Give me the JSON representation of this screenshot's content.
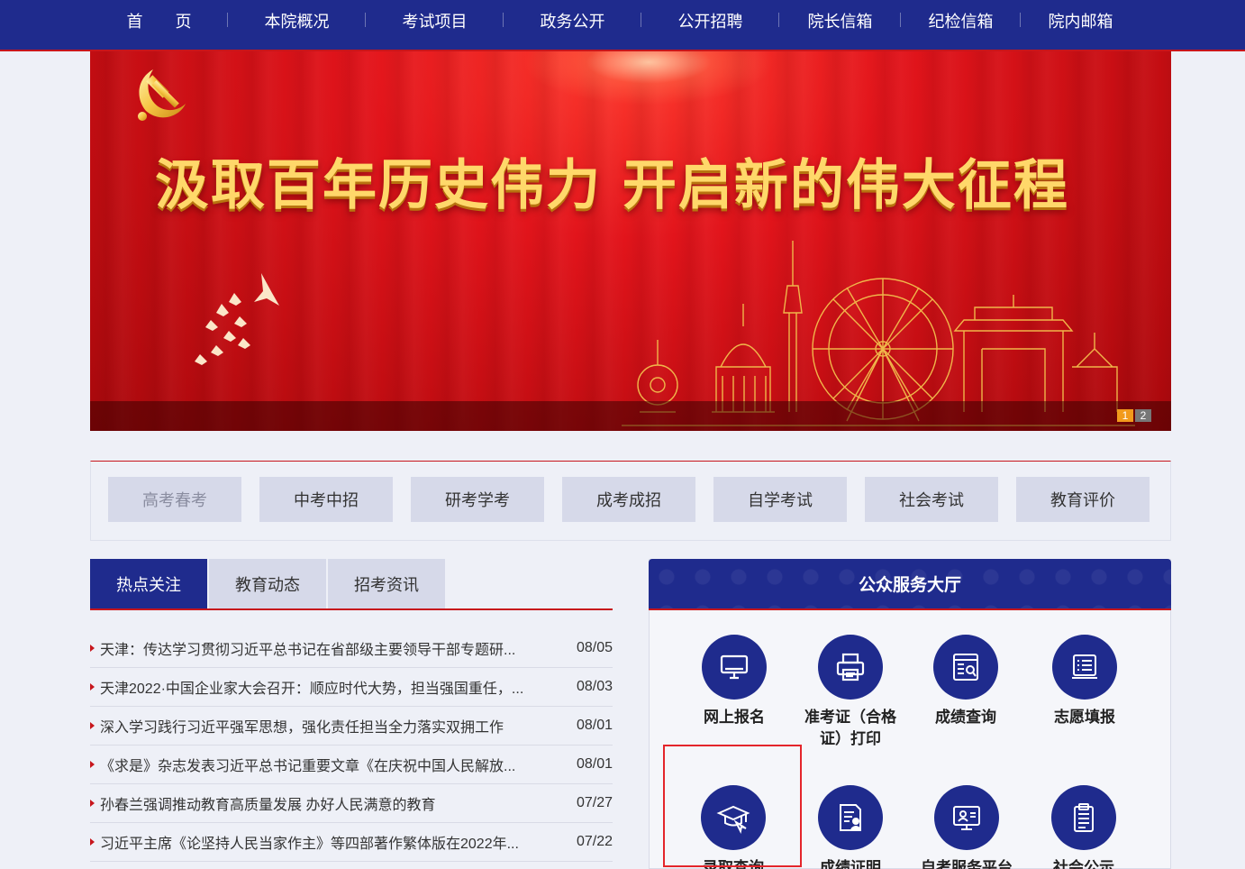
{
  "nav": {
    "items": [
      "首　　页",
      "本院概况",
      "考试项目",
      "政务公开",
      "公开招聘",
      "院长信箱",
      "纪检信箱",
      "院内邮箱"
    ]
  },
  "banner": {
    "headline": "汲取百年历史伟力  开启新的伟大征程",
    "pages": [
      "1",
      "2"
    ],
    "active_page": "1"
  },
  "categories": {
    "items": [
      "高考春考",
      "中考中招",
      "研考学考",
      "成考成招",
      "自学考试",
      "社会考试",
      "教育评价"
    ],
    "selected": "高考春考"
  },
  "news": {
    "tabs": [
      "热点关注",
      "教育动态",
      "招考资讯"
    ],
    "active_tab": "热点关注",
    "items": [
      {
        "title": "天津：传达学习贯彻习近平总书记在省部级主要领导干部专题研...",
        "date": "08/05"
      },
      {
        "title": "天津2022·中国企业家大会召开：顺应时代大势，担当强国重任，...",
        "date": "08/03"
      },
      {
        "title": "深入学习践行习近平强军思想，强化责任担当全力落实双拥工作",
        "date": "08/01"
      },
      {
        "title": "《求是》杂志发表习近平总书记重要文章《在庆祝中国人民解放...",
        "date": "08/01"
      },
      {
        "title": "孙春兰强调推动教育高质量发展 办好人民满意的教育",
        "date": "07/27"
      },
      {
        "title": "习近平主席《论坚持人民当家作主》等四部著作繁体版在2022年...",
        "date": "07/22"
      }
    ]
  },
  "service": {
    "title": "公众服务大厅",
    "items": [
      {
        "label": "网上报名",
        "icon": "monitor-icon"
      },
      {
        "label": "准考证（合格证）打印",
        "icon": "printer-icon"
      },
      {
        "label": "成绩查询",
        "icon": "score-query-icon"
      },
      {
        "label": "志愿填报",
        "icon": "list-form-icon"
      },
      {
        "label": "录取查询",
        "icon": "graduation-cap-icon"
      },
      {
        "label": "成绩证明",
        "icon": "certificate-icon"
      },
      {
        "label": "自考服务平台",
        "icon": "computer-user-icon"
      },
      {
        "label": "社会公示",
        "icon": "clipboard-icon"
      }
    ]
  },
  "colors": {
    "nav_blue": "#1f2b8d",
    "accent_red": "#c7161c",
    "banner_red": "#e2141b",
    "gold": "#ffd86a",
    "tab_gray": "#d6d9e9"
  }
}
